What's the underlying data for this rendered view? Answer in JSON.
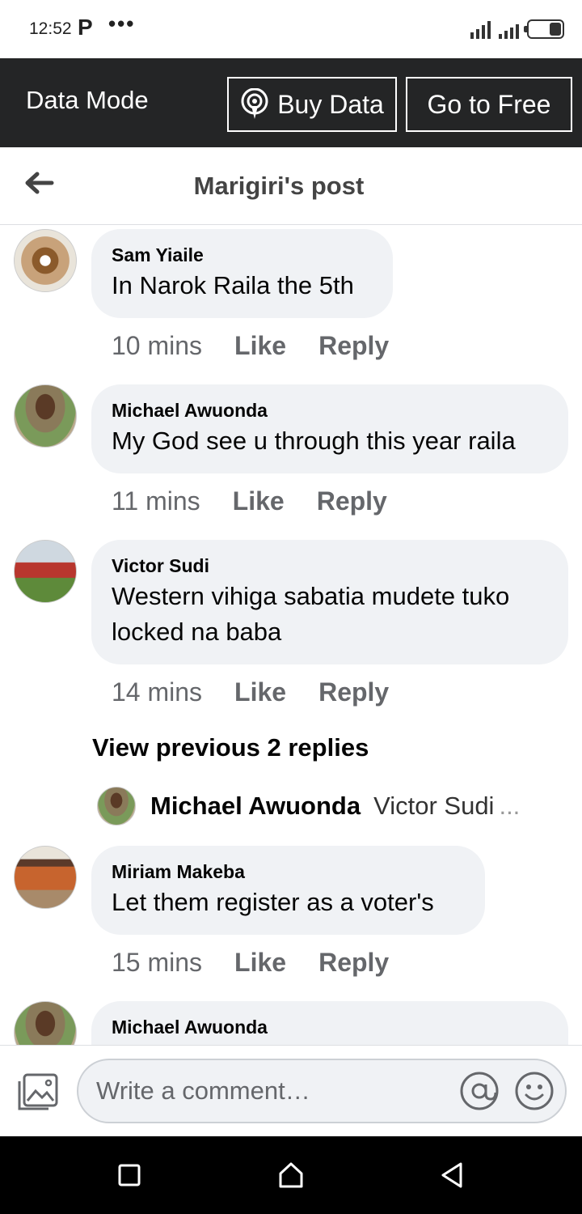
{
  "status_bar": {
    "time": "12:52",
    "p_label": "P",
    "dots": "•••"
  },
  "data_mode": {
    "title": "Data Mode",
    "buy_label": "Buy Data",
    "free_label": "Go to Free"
  },
  "header": {
    "title": "Marigiri's post"
  },
  "comments": [
    {
      "author": "Sam Yiaile",
      "text": "In Narok Raila the 5th",
      "time": "10 mins",
      "like": "Like",
      "reply": "Reply"
    },
    {
      "author": "Michael Awuonda",
      "text": "My God see u through this year raila",
      "time": "11 mins",
      "like": "Like",
      "reply": "Reply"
    },
    {
      "author": "Victor Sudi",
      "text": "Western vihiga sabatia mudete tuko locked na baba",
      "time": "14 mins",
      "like": "Like",
      "reply": "Reply"
    },
    {
      "author": "Miriam Makeba",
      "text": "Let them register as a voter's",
      "time": "15 mins",
      "like": "Like",
      "reply": "Reply"
    },
    {
      "author": "Michael Awuonda"
    }
  ],
  "replies": {
    "view_previous": "View previous 2 replies",
    "preview_author": "Michael Awuonda",
    "preview_text": "Victor Sudi",
    "ellipsis": "..."
  },
  "composer": {
    "placeholder": "Write a comment…"
  },
  "colors": {
    "data_bar": "#242526",
    "bubble": "#f0f2f5",
    "meta": "#65676b",
    "nav": "#000000"
  }
}
